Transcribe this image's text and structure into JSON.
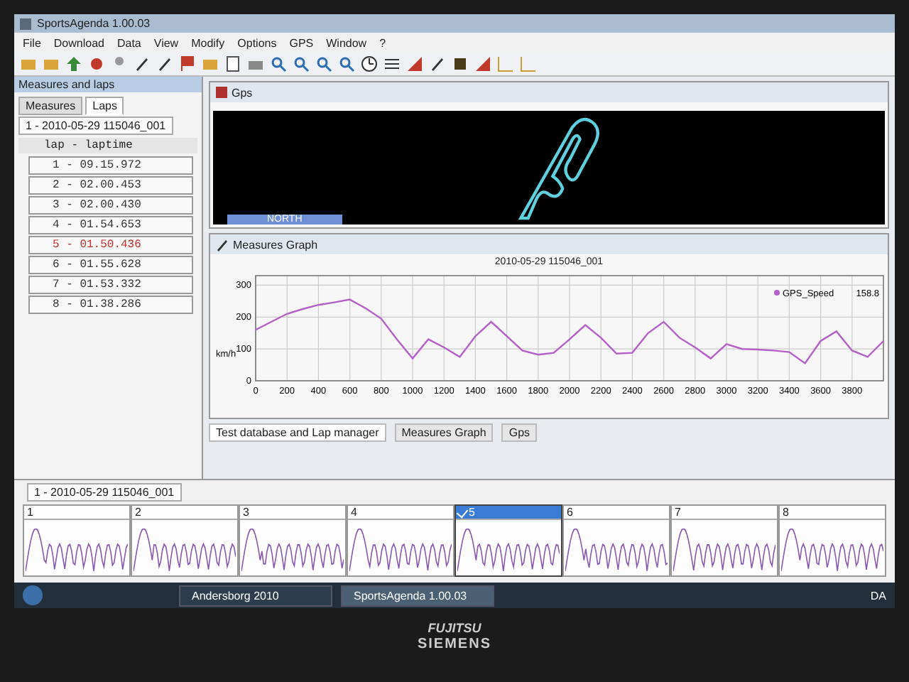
{
  "window": {
    "title": "SportsAgenda 1.00.03"
  },
  "menu": [
    "File",
    "Download",
    "Data",
    "View",
    "Modify",
    "Options",
    "GPS",
    "Window",
    "?"
  ],
  "left_panel": {
    "title": "Measures and laps",
    "tabs": [
      {
        "label": "Measures",
        "selected": false
      },
      {
        "label": "Laps",
        "selected": true
      }
    ],
    "session_tab": "1 - 2010-05-29 115046_001",
    "list_header": "lap - laptime",
    "laps": [
      {
        "label": "1 - 09.15.972",
        "best": false
      },
      {
        "label": "2 - 02.00.453",
        "best": false
      },
      {
        "label": "3 - 02.00.430",
        "best": false
      },
      {
        "label": "4 - 01.54.653",
        "best": false
      },
      {
        "label": "5 - 01.50.436",
        "best": true
      },
      {
        "label": "6 - 01.55.628",
        "best": false
      },
      {
        "label": "7 - 01.53.332",
        "best": false
      },
      {
        "label": "8 - 01.38.286",
        "best": false
      }
    ]
  },
  "gps_panel": {
    "title": "Gps",
    "compass_label": "NORTH"
  },
  "graph_panel": {
    "title": "Measures Graph",
    "legend_reading": "158.8",
    "chart_data": {
      "type": "line",
      "title": "2010-05-29 115046_001",
      "ylabel": "km/h",
      "x": [
        0,
        100,
        200,
        300,
        400,
        500,
        600,
        700,
        800,
        900,
        1000,
        1100,
        1200,
        1300,
        1400,
        1500,
        1600,
        1700,
        1800,
        1900,
        2000,
        2100,
        2200,
        2300,
        2400,
        2500,
        2600,
        2700,
        2800,
        2900,
        3000,
        3100,
        3200,
        3300,
        3400,
        3500,
        3600,
        3700,
        3800,
        3900,
        4000
      ],
      "series": [
        {
          "name": "GPS_Speed",
          "color": "#b560c8",
          "values": [
            160,
            185,
            210,
            225,
            238,
            246,
            255,
            228,
            195,
            130,
            70,
            130,
            105,
            75,
            140,
            185,
            140,
            95,
            82,
            88,
            130,
            175,
            135,
            85,
            88,
            150,
            185,
            135,
            105,
            70,
            115,
            100,
            98,
            95,
            90,
            55,
            125,
            155,
            95,
            75,
            125
          ]
        }
      ],
      "xlim": [
        0,
        4000
      ],
      "ylim": [
        0,
        330
      ],
      "grid": true,
      "xticks": [
        0,
        200,
        400,
        600,
        800,
        1000,
        1200,
        1400,
        1600,
        1800,
        2000,
        2200,
        2400,
        2600,
        2800,
        3000,
        3200,
        3400,
        3600,
        3800
      ],
      "yticks": [
        0,
        100,
        200,
        300
      ]
    }
  },
  "bottom_tabs": [
    {
      "label": "Test database and Lap manager",
      "selected": true
    },
    {
      "label": "Measures Graph",
      "selected": false
    },
    {
      "label": "Gps",
      "selected": false
    }
  ],
  "lap_strip": {
    "session_tab": "1 - 2010-05-29 115046_001",
    "laps": [
      {
        "label": "1",
        "selected": false
      },
      {
        "label": "2",
        "selected": false
      },
      {
        "label": "3",
        "selected": false
      },
      {
        "label": "4",
        "selected": false
      },
      {
        "label": "5",
        "selected": true
      },
      {
        "label": "6",
        "selected": false
      },
      {
        "label": "7",
        "selected": false
      },
      {
        "label": "8",
        "selected": false
      }
    ]
  },
  "taskbar": {
    "items": [
      {
        "label": "Andersborg 2010",
        "selected": false
      },
      {
        "label": "SportsAgenda 1.00.03",
        "selected": true
      }
    ],
    "language": "DA"
  },
  "bezel": {
    "brand_top": "FUJITSU",
    "brand_bottom": "SIEMENS"
  }
}
